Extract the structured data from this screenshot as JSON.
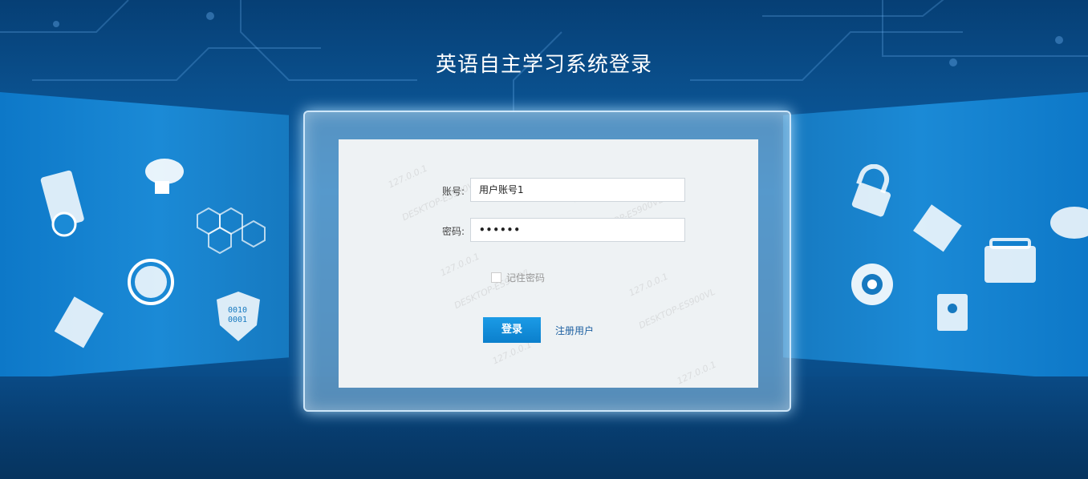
{
  "page": {
    "title": "英语自主学习系统登录"
  },
  "form": {
    "account_label": "账号:",
    "account_value": "用户账号1",
    "password_label": "密码:",
    "password_value": "••••••",
    "remember_label": "记住密码",
    "login_label": "登录",
    "register_label": "注册用户"
  },
  "watermark": {
    "ip": "127.0.0.1",
    "host": "DESKTOP-ES900VL"
  },
  "decor": {
    "left_icons": [
      "server-lock-icon",
      "cloud-lock-icon",
      "hexagon-network-icon",
      "globe-icon",
      "photos-icon",
      "shield-binary-icon"
    ],
    "right_icons": [
      "globe-lock-icon",
      "folder-icon",
      "gear-icon",
      "briefcase-icon",
      "contacts-icon",
      "cloud-icon"
    ],
    "binary_text": "0010\n0001"
  },
  "colors": {
    "accent": "#0b7fcc",
    "link": "#1c5fa0",
    "background": "#0a5fa6"
  }
}
